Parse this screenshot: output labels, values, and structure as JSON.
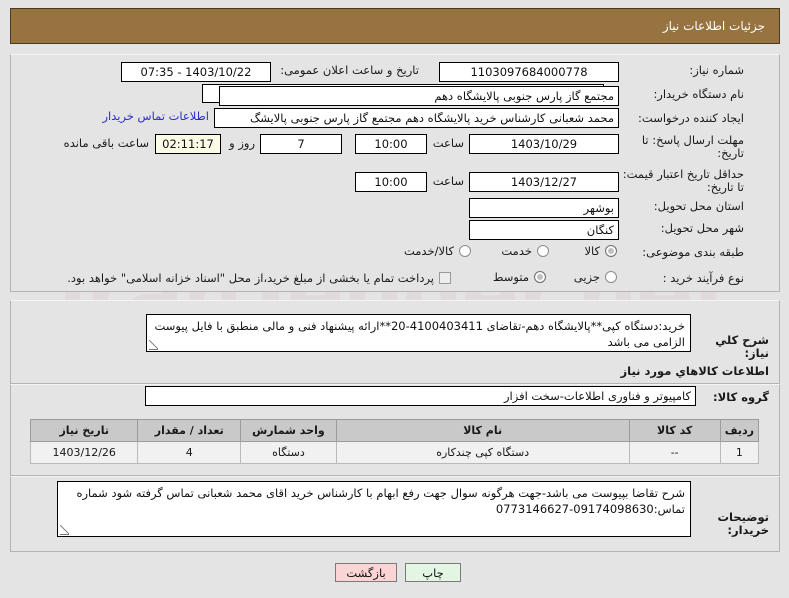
{
  "header": {
    "title": "جزئیات اطلاعات نیاز"
  },
  "form": {
    "labels": {
      "need_number": "شماره نیاز:",
      "buyer_org": "نام دستگاه خریدار:",
      "creator": "ایجاد کننده درخواست:",
      "answer_deadline": "مهلت ارسال پاسخ: تا تاریخ:",
      "price_validity": "حداقل تاریخ اعتبار قیمت: تا تاریخ:",
      "delivery_province": "استان محل تحویل:",
      "delivery_city": "شهر محل تحویل:",
      "subject_category": "طبقه بندی موضوعی:",
      "purchase_type": "نوع فرآیند خرید :",
      "public_announce_datetime": "تاریخ و ساعت اعلان عمومی:",
      "hour": "ساعت",
      "day_and": "روز و",
      "hours_remaining": "ساعت باقی مانده"
    },
    "values": {
      "need_number": "1103097684000778",
      "public_announce_datetime": "1403/10/22 - 07:35",
      "buyer_org": "مجتمع گاز پارس جنوبی  پالایشگاه دهم",
      "buyer_org_secondary": "",
      "creator": "محمد شعبانی کارشناس خرید پالایشگاه دهم  مجتمع گاز پارس جنوبی  پالایشگ",
      "buyer_contact_link": "اطلاعات تماس خریدار",
      "answer_deadline_date": "1403/10/29",
      "answer_deadline_time": "10:00",
      "days_remaining": "7",
      "time_remaining": "02:11:17",
      "price_validity_date": "1403/12/27",
      "price_validity_time": "10:00",
      "delivery_province": "بوشهر",
      "delivery_city": "کنگان"
    },
    "subject_category_options": [
      {
        "label": "کالا",
        "selected": true
      },
      {
        "label": "خدمت",
        "selected": false
      },
      {
        "label": "کالا/خدمت",
        "selected": false
      }
    ],
    "purchase_type_options": [
      {
        "label": "جزیی",
        "selected": false
      },
      {
        "label": "متوسط",
        "selected": true
      }
    ],
    "treasury_checkbox": {
      "label": "پرداخت تمام یا بخشی از مبلغ خرید،از محل \"اسناد خزانه اسلامی\" خواهد بود.",
      "checked": false
    }
  },
  "description": {
    "label": "شرح کلي نیاز:",
    "text": "خرید:دستگاه کپی**پالایشگاه دهم-تقاضای 4100403411-20**ارائه پیشنهاد فنی و مالی منطبق با فایل پیوست الزامی می باشد"
  },
  "goods": {
    "section_title": "اطلاعات کالاهاي مورد نیاز",
    "group_label": "گروه کالا:",
    "group_value": "کامپیوتر و فناوری اطلاعات-سخت افزار",
    "columns": [
      "ردیف",
      "کد کالا",
      "نام کالا",
      "واحد شمارش",
      "تعداد / مقدار",
      "تاریخ نیاز"
    ],
    "rows": [
      {
        "index": "1",
        "code": "--",
        "name": "دستگاه کپی چندکاره",
        "unit": "دستگاه",
        "quantity": "4",
        "need_date": "1403/12/26"
      }
    ]
  },
  "notes": {
    "label": "توضیحات خریدار:",
    "text": "شرح تقاضا بپیوست می باشد-جهت هرگونه سوال جهت رفع ابهام با کارشناس خرید اقای محمد شعبانی تماس گرفته شود شماره تماس:09174098630-0773146627"
  },
  "footer": {
    "print_label": "چاپ",
    "back_label": "بازگشت"
  },
  "watermark": {
    "text": "iranTender.net"
  },
  "colors": {
    "header_bg": "#96733f",
    "page_bg": "#e4e4e4",
    "link": "#2b2bd0",
    "print_btn": "#e3f6e3",
    "back_btn": "#fbd5d5",
    "timer_bg": "#fbfbe6"
  }
}
